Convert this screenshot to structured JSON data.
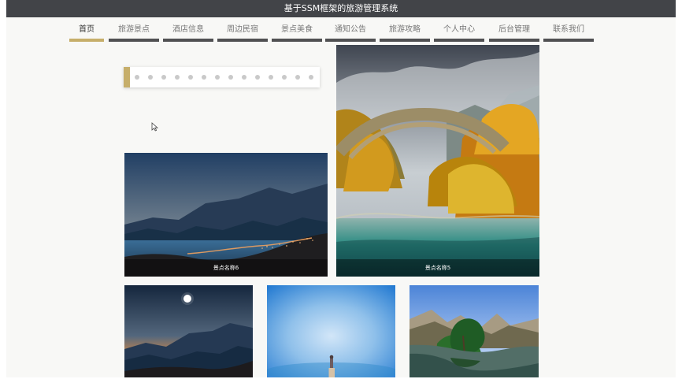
{
  "header": {
    "title": "基于SSM框架的旅游管理系统"
  },
  "nav": {
    "items": [
      {
        "label": "首页",
        "active": true
      },
      {
        "label": "旅游景点",
        "active": false
      },
      {
        "label": "酒店信息",
        "active": false
      },
      {
        "label": "周边民宿",
        "active": false
      },
      {
        "label": "景点美食",
        "active": false
      },
      {
        "label": "通知公告",
        "active": false
      },
      {
        "label": "旅游攻略",
        "active": false
      },
      {
        "label": "个人中心",
        "active": false
      },
      {
        "label": "后台管理",
        "active": false
      },
      {
        "label": "联系我们",
        "active": false
      }
    ]
  },
  "banner": {
    "dots": 14,
    "active_index": 0
  },
  "cards": {
    "large_left": {
      "caption": "景点名称6"
    },
    "large_right": {
      "caption": "景点名称5"
    }
  },
  "colors": {
    "topbar": "#424448",
    "accent": "#c6ae6a",
    "nav_underline": "#505052"
  }
}
